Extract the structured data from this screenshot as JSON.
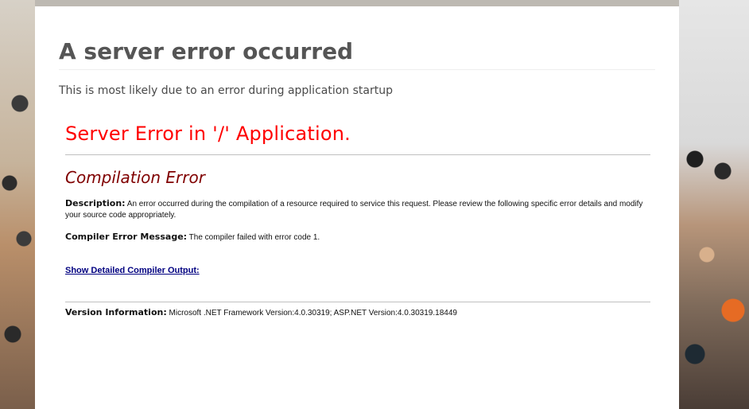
{
  "page": {
    "title": "A server error occurred",
    "subtitle": "This is most likely due to an error during application startup"
  },
  "aspnet": {
    "heading": "Server Error in '/' Application.",
    "subheading": "Compilation Error",
    "description_label": "Description:",
    "description_text": "An error occurred during the compilation of a resource required to service this request. Please review the following specific error details and modify your source code appropriately.",
    "compiler_label": "Compiler Error Message:",
    "compiler_text": "The compiler failed with error code 1.",
    "detailed_link": "Show Detailed Compiler Output:",
    "version_label": "Version Information:",
    "version_text": "Microsoft .NET Framework Version:4.0.30319; ASP.NET Version:4.0.30319.18449"
  }
}
